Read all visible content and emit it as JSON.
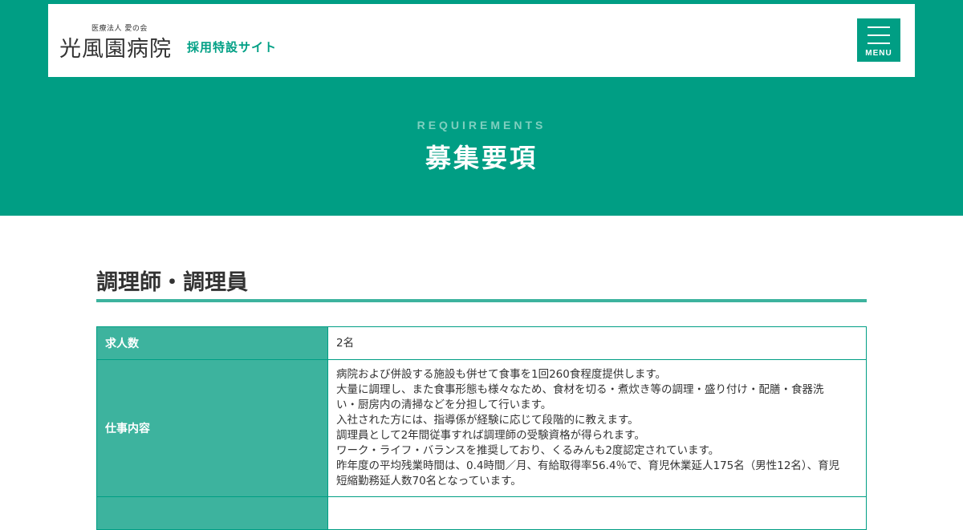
{
  "header": {
    "logo_sub": "医療法人 愛の会",
    "logo_main": "光風園病院",
    "logo_tag": "採用特設サイト",
    "menu_label": "MENU"
  },
  "hero": {
    "en": "REQUIREMENTS",
    "ja": "募集要項"
  },
  "section": {
    "title": "調理師・調理員"
  },
  "table": {
    "rows": [
      {
        "label": "求人数",
        "lines": [
          "2名"
        ]
      },
      {
        "label": "仕事内容",
        "lines": [
          "病院および併設する施設も併せて食事を1回260食程度提供します。",
          "大量に調理し、また食事形態も様々なため、食材を切る・煮炊き等の調理・盛り付け・配膳・食器洗",
          "い・厨房内の清掃などを分担して行います。",
          "入社された方には、指導係が経験に応じて段階的に教えます。",
          "調理員として2年間従事すれば調理師の受験資格が得られます。",
          "ワーク・ライフ・バランスを推奨しており、くるみんも2度認定されています。",
          "昨年度の平均残業時間は、0.4時間／月、有給取得率56.4％で、育児休業延人175名（男性12名）、育児",
          "短縮勤務延人数70名となっています。"
        ]
      },
      {
        "label": "",
        "lines": [
          ""
        ]
      }
    ]
  },
  "colors": {
    "brand_green": "#009e84",
    "table_header": "#3db39e",
    "hero_en_text": "#7fcfbf"
  },
  "icons": {
    "menu": "hamburger-icon"
  }
}
